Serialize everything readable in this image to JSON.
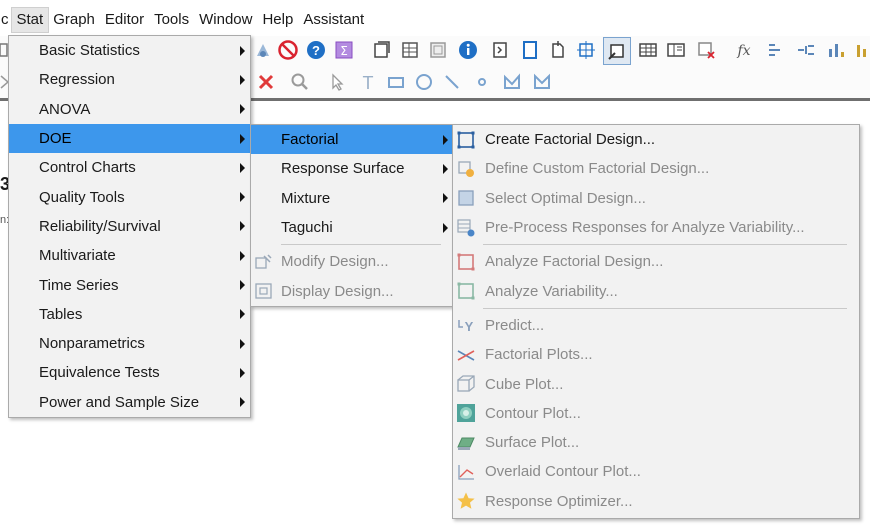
{
  "menubar": {
    "lead": "c",
    "items": [
      "Stat",
      "Graph",
      "Editor",
      "Tools",
      "Window",
      "Help",
      "Assistant"
    ],
    "active": "Stat"
  },
  "background": {
    "edge_digit": "3",
    "edge_text": "n:"
  },
  "stat_menu": {
    "items": [
      {
        "label": "Basic Statistics"
      },
      {
        "label": "Regression"
      },
      {
        "label": "ANOVA"
      },
      {
        "label": "DOE",
        "highlighted": true
      },
      {
        "label": "Control Charts"
      },
      {
        "label": "Quality Tools"
      },
      {
        "label": "Reliability/Survival"
      },
      {
        "label": "Multivariate"
      },
      {
        "label": "Time Series"
      },
      {
        "label": "Tables"
      },
      {
        "label": "Nonparametrics"
      },
      {
        "label": "Equivalence Tests"
      },
      {
        "label": "Power and Sample Size"
      }
    ]
  },
  "doe_menu": {
    "items": [
      {
        "label": "Factorial",
        "highlighted": true
      },
      {
        "label": "Response Surface"
      },
      {
        "label": "Mixture"
      },
      {
        "label": "Taguchi"
      },
      {
        "label": "Modify Design...",
        "icon": "modify-design-icon",
        "disabled": true
      },
      {
        "label": "Display Design...",
        "icon": "display-design-icon",
        "disabled": true
      }
    ]
  },
  "factorial_menu": {
    "items": [
      {
        "label": "Create Factorial Design...",
        "icon": "create-factorial-design-icon",
        "enabled": true
      },
      {
        "label": "Define Custom Factorial Design...",
        "icon": "define-custom-design-icon"
      },
      {
        "label": "Select Optimal Design...",
        "icon": "select-optimal-design-icon"
      },
      {
        "label": "Pre-Process Responses for Analyze Variability...",
        "icon": "preprocess-responses-icon"
      },
      {
        "label": "Analyze Factorial Design...",
        "icon": "analyze-factorial-design-icon"
      },
      {
        "label": "Analyze Variability...",
        "icon": "analyze-variability-icon"
      },
      {
        "label": "Predict...",
        "icon": "predict-icon"
      },
      {
        "label": "Factorial Plots...",
        "icon": "factorial-plots-icon"
      },
      {
        "label": "Cube Plot...",
        "icon": "cube-plot-icon"
      },
      {
        "label": "Contour Plot...",
        "icon": "contour-plot-icon"
      },
      {
        "label": "Surface Plot...",
        "icon": "surface-plot-icon"
      },
      {
        "label": "Overlaid Contour Plot...",
        "icon": "overlaid-contour-plot-icon"
      },
      {
        "label": "Response Optimizer...",
        "icon": "response-optimizer-icon"
      }
    ]
  },
  "colors": {
    "highlight": "#3d97ec",
    "menu_bg": "#f2f2f2",
    "disabled_text": "#8a8a8a",
    "stop_icon": "#d9232f",
    "help_icon": "#1f6fc5",
    "sigma_icon": "#8a4cc2",
    "close_x": "#e03a3a"
  }
}
